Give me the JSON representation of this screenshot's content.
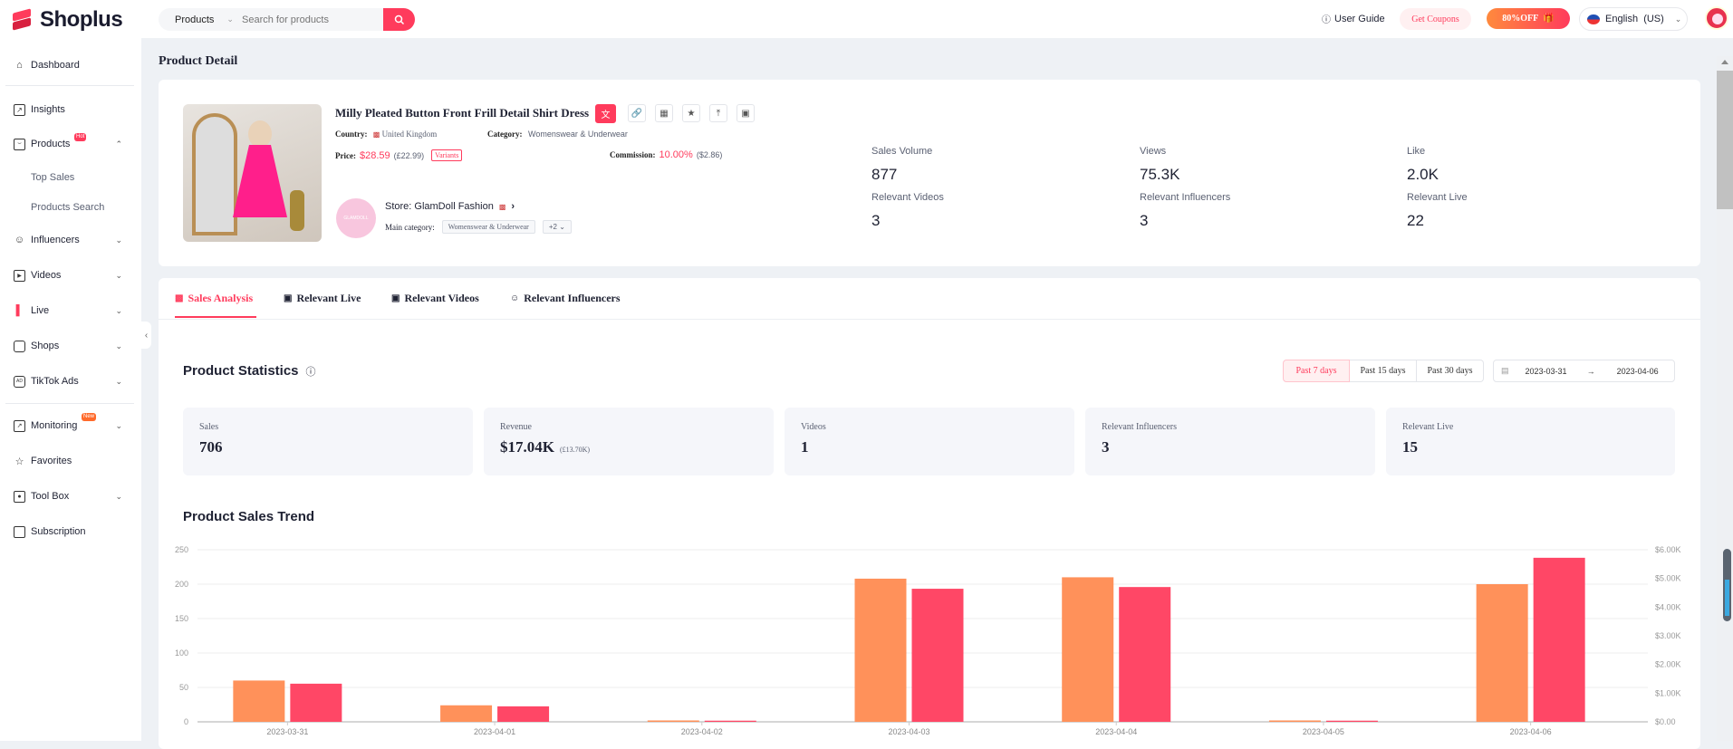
{
  "app": {
    "name": "Shoplus"
  },
  "topbar": {
    "search_scope": "Products",
    "search_placeholder": "Search for products",
    "user_guide": "User Guide",
    "get_coupons": "Get Coupons",
    "promo": "80%OFF",
    "language": "English  (US)"
  },
  "sidebar": {
    "items": [
      {
        "label": "Dashboard",
        "icon": "home-icon"
      },
      {
        "label": "Insights",
        "icon": "chart-icon"
      },
      {
        "label": "Products",
        "icon": "bag-icon",
        "badge": "Hot",
        "expanded": true
      },
      {
        "label": "Influencers",
        "icon": "user-icon"
      },
      {
        "label": "Videos",
        "icon": "video-icon"
      },
      {
        "label": "Live",
        "icon": "live-icon"
      },
      {
        "label": "Shops",
        "icon": "shop-icon"
      },
      {
        "label": "TikTok Ads",
        "icon": "ads-icon"
      },
      {
        "label": "Monitoring",
        "icon": "monitor-icon",
        "badge": "New"
      },
      {
        "label": "Favorites",
        "icon": "star-icon"
      },
      {
        "label": "Tool Box",
        "icon": "toolbox-icon"
      },
      {
        "label": "Subscription",
        "icon": "card-icon"
      }
    ],
    "subitems": [
      "Top Sales",
      "Products Search"
    ]
  },
  "page": {
    "title": "Product Detail"
  },
  "product": {
    "title": "Milly Pleated Button Front Frill Detail Shirt Dress",
    "country_label": "Country:",
    "country": "United Kingdom",
    "category_label": "Category:",
    "category": "Womenswear & Underwear",
    "price_label": "Price:",
    "price": "$28.59",
    "price_local": "(£22.99)",
    "variants": "Variants",
    "commission_label": "Commission:",
    "commission": "10.00%",
    "commission_amount": "($2.86)",
    "store": "Store: GlamDoll Fashion",
    "store_logo_text": "GLAMDOLL",
    "main_category_label": "Main category:",
    "main_category": "Womenswear & Underwear",
    "more_categories": "+2"
  },
  "kpis": [
    {
      "label": "Sales Volume",
      "value": "877"
    },
    {
      "label": "Views",
      "value": "75.3K"
    },
    {
      "label": "Like",
      "value": "2.0K"
    },
    {
      "label": "Relevant Videos",
      "value": "3"
    },
    {
      "label": "Relevant Influencers",
      "value": "3"
    },
    {
      "label": "Relevant Live",
      "value": "22"
    }
  ],
  "tabs": [
    {
      "label": "Sales Analysis",
      "active": true
    },
    {
      "label": "Relevant Live"
    },
    {
      "label": "Relevant Videos"
    },
    {
      "label": "Relevant Influencers"
    }
  ],
  "statistics": {
    "title": "Product Statistics",
    "ranges": [
      "Past 7 days",
      "Past 15 days",
      "Past 30 days"
    ],
    "active_range": "Past 7 days",
    "date_from": "2023-03-31",
    "date_to": "2023-04-06",
    "cards": [
      {
        "label": "Sales",
        "value": "706"
      },
      {
        "label": "Revenue",
        "value": "$17.04K",
        "sub": "(£13.70K)"
      },
      {
        "label": "Videos",
        "value": "1"
      },
      {
        "label": "Relevant Influencers",
        "value": "3"
      },
      {
        "label": "Relevant Live",
        "value": "15"
      }
    ]
  },
  "trend": {
    "title": "Product Sales Trend"
  },
  "colors": {
    "accent": "#ff3b5c",
    "sales_bar": "#ff915a",
    "revenue_bar": "#ff4766"
  },
  "chart_data": {
    "type": "bar",
    "title": "Product Sales Trend",
    "categories": [
      "2023-03-31",
      "2023-04-01",
      "2023-04-02",
      "2023-04-03",
      "2023-04-04",
      "2023-04-05",
      "2023-04-06"
    ],
    "series": [
      {
        "name": "Sales",
        "axis": "left",
        "values": [
          60,
          24,
          2,
          208,
          210,
          2,
          200
        ]
      },
      {
        "name": "Revenue",
        "axis": "right",
        "values": [
          1330,
          540,
          40,
          4640,
          4700,
          40,
          5720
        ]
      }
    ],
    "left_axis": {
      "ylim": [
        0,
        250
      ],
      "ticks": [
        "0",
        "50",
        "100",
        "150",
        "200",
        "250"
      ]
    },
    "right_axis": {
      "ylim": [
        0,
        6000
      ],
      "ticks": [
        "$0.00",
        "$1.00K",
        "$2.00K",
        "$3.00K",
        "$4.00K",
        "$5.00K",
        "$6.00K"
      ]
    },
    "grid": true
  }
}
